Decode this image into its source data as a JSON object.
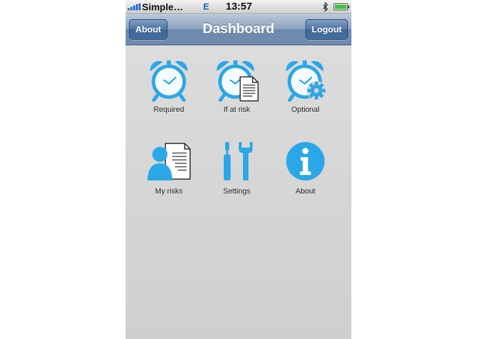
{
  "status_bar": {
    "carrier": "Simple…",
    "network": "E",
    "time": "13:57",
    "icons": [
      "signal-strength-icon",
      "bluetooth-icon",
      "battery-icon"
    ]
  },
  "nav_bar": {
    "title": "Dashboard",
    "left_button": "About",
    "right_button": "Logout"
  },
  "grid": {
    "items": [
      {
        "label": "Required",
        "icon": "alarm-clock-icon"
      },
      {
        "label": "If at risk",
        "icon": "alarm-clock-document-icon"
      },
      {
        "label": "Optional",
        "icon": "alarm-clock-gear-icon"
      },
      {
        "label": "My risks",
        "icon": "person-document-icon"
      },
      {
        "label": "Settings",
        "icon": "tools-icon"
      },
      {
        "label": "About",
        "icon": "info-icon"
      }
    ]
  },
  "colors": {
    "icon_blue": "#2aa7e6",
    "nav_bar": "#6f8cb0",
    "background": "#d7d7d7"
  }
}
